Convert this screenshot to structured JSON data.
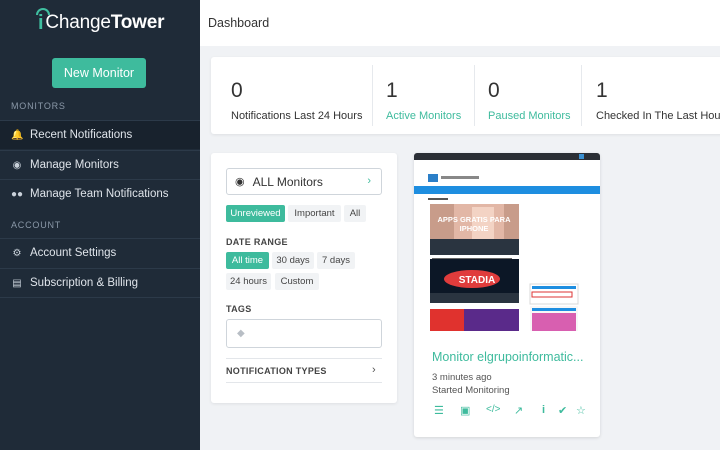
{
  "brand": {
    "prefix": "Change",
    "bold": "Tower"
  },
  "sidebar": {
    "new_monitor": "New Monitor",
    "monitors_heading": "MONITORS",
    "account_heading": "ACCOUNT",
    "items": [
      {
        "label": "Recent Notifications",
        "icon": "bell-icon"
      },
      {
        "label": "Manage Monitors",
        "icon": "eye-icon"
      },
      {
        "label": "Manage Team Notifications",
        "icon": "users-icon"
      },
      {
        "label": "Account Settings",
        "icon": "gear-icon"
      },
      {
        "label": "Subscription & Billing",
        "icon": "credit-card-icon"
      }
    ]
  },
  "header": {
    "title": "Dashboard"
  },
  "stats": [
    {
      "value": "0",
      "label": "Notifications Last 24 Hours"
    },
    {
      "value": "1",
      "label": "Active Monitors"
    },
    {
      "value": "0",
      "label": "Paused Monitors"
    },
    {
      "value": "1",
      "label": "Checked In The Last Hour"
    }
  ],
  "filters": {
    "monitor_select": "ALL Monitors",
    "status_tabs": [
      "Unreviewed",
      "Important",
      "All"
    ],
    "date_range_label": "DATE RANGE",
    "date_ranges": [
      "All time",
      "30 days",
      "7 days",
      "24 hours",
      "Custom"
    ],
    "tags_label": "TAGS",
    "notification_types": "NOTIFICATION TYPES"
  },
  "monitor_card": {
    "title": "Monitor elgrupoinformatic...",
    "time": "3 minutes ago",
    "status": "Started Monitoring",
    "thumb_headline_1": "APPS GRATIS PARA",
    "thumb_headline_2": "IPHONE",
    "thumb_stadia": "STADIA",
    "actions": [
      "menu-icon",
      "camera-icon",
      "code-icon",
      "external-link-icon",
      "info-icon",
      "check-circle-icon",
      "star-icon"
    ]
  },
  "colors": {
    "accent": "#3ebb9d",
    "sidebar": "#1f2b38"
  }
}
